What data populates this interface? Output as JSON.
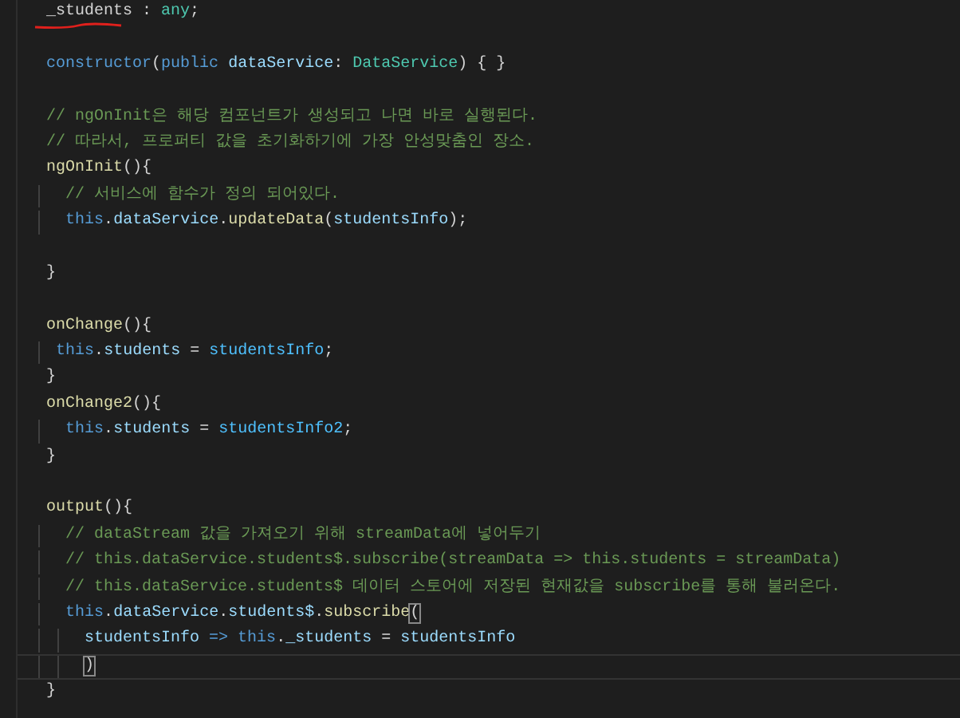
{
  "editor": {
    "lines": [
      {
        "current": false,
        "tokens": [
          {
            "kind": "plain",
            "text": "_students : "
          },
          {
            "kind": "type",
            "text": "any"
          },
          {
            "kind": "plain",
            "text": ";"
          }
        ]
      },
      {
        "current": false
      },
      {
        "current": false,
        "tokens": [
          {
            "kind": "keyword",
            "text": "constructor"
          },
          {
            "kind": "plain",
            "text": "("
          },
          {
            "kind": "keyword",
            "text": "public"
          },
          {
            "kind": "variable",
            "text": " dataService"
          },
          {
            "kind": "plain",
            "text": ": "
          },
          {
            "kind": "type",
            "text": "DataService"
          },
          {
            "kind": "plain",
            "text": ") { }"
          }
        ]
      },
      {
        "current": false
      },
      {
        "current": false,
        "tokens": [
          {
            "kind": "comment",
            "text": "// ngOnInit은 해당 컴포넌트가 생성되고 나면 바로 실행된다."
          }
        ]
      },
      {
        "current": false,
        "tokens": [
          {
            "kind": "comment",
            "text": "// 따라서, 프로퍼티 값을 초기화하기에 가장 안성맞춤인 장소."
          }
        ]
      },
      {
        "current": false,
        "tokens": [
          {
            "kind": "function",
            "text": "ngOnInit"
          },
          {
            "kind": "plain",
            "text": "(){"
          }
        ]
      },
      {
        "current": false,
        "tokens": [
          {
            "kind": "comment",
            "text": "  // 서비스에 함수가 정의 되어있다."
          }
        ]
      },
      {
        "current": false,
        "tokens": [
          {
            "kind": "keyword",
            "text": "  this"
          },
          {
            "kind": "plain",
            "text": "."
          },
          {
            "kind": "variable",
            "text": "dataService"
          },
          {
            "kind": "plain",
            "text": "."
          },
          {
            "kind": "function",
            "text": "updateData"
          },
          {
            "kind": "plain",
            "text": "("
          },
          {
            "kind": "variable",
            "text": "studentsInfo"
          },
          {
            "kind": "plain",
            "text": ");"
          }
        ]
      },
      {
        "current": false
      },
      {
        "current": false,
        "tokens": [
          {
            "kind": "plain",
            "text": "}"
          }
        ]
      },
      {
        "current": false
      },
      {
        "current": false,
        "tokens": [
          {
            "kind": "function",
            "text": "onChange"
          },
          {
            "kind": "plain",
            "text": "(){"
          }
        ]
      },
      {
        "current": false,
        "tokens": [
          {
            "kind": "keyword",
            "text": " this"
          },
          {
            "kind": "plain",
            "text": "."
          },
          {
            "kind": "variable",
            "text": "students"
          },
          {
            "kind": "plain",
            "text": " = "
          },
          {
            "kind": "ident",
            "text": "studentsInfo"
          },
          {
            "kind": "plain",
            "text": ";"
          }
        ]
      },
      {
        "current": false,
        "tokens": [
          {
            "kind": "plain",
            "text": "}"
          }
        ]
      },
      {
        "current": false,
        "tokens": [
          {
            "kind": "function",
            "text": "onChange2"
          },
          {
            "kind": "plain",
            "text": "(){"
          }
        ]
      },
      {
        "current": false,
        "tokens": [
          {
            "kind": "keyword",
            "text": "  this"
          },
          {
            "kind": "plain",
            "text": "."
          },
          {
            "kind": "variable",
            "text": "students"
          },
          {
            "kind": "plain",
            "text": " = "
          },
          {
            "kind": "ident",
            "text": "studentsInfo2"
          },
          {
            "kind": "plain",
            "text": ";"
          }
        ]
      },
      {
        "current": false,
        "tokens": [
          {
            "kind": "plain",
            "text": "}"
          }
        ]
      },
      {
        "current": false
      },
      {
        "current": false,
        "tokens": [
          {
            "kind": "function",
            "text": "output"
          },
          {
            "kind": "plain",
            "text": "(){"
          }
        ]
      },
      {
        "current": false,
        "tokens": [
          {
            "kind": "comment",
            "text": "  // dataStream 값을 가져오기 위해 streamData에 넣어두기"
          }
        ]
      },
      {
        "current": false,
        "tokens": [
          {
            "kind": "comment",
            "text": "  // this.dataService.students$.subscribe(streamData => this.students = streamData)"
          }
        ]
      },
      {
        "current": false,
        "tokens": [
          {
            "kind": "comment",
            "text": "  // this.dataService.students$ 데이터 스토어에 저장된 현재값을 subscribe를 통해 불러온다."
          }
        ]
      },
      {
        "current": false,
        "tokens": [
          {
            "kind": "keyword",
            "text": "  this"
          },
          {
            "kind": "plain",
            "text": "."
          },
          {
            "kind": "variable",
            "text": "dataService"
          },
          {
            "kind": "plain",
            "text": "."
          },
          {
            "kind": "variable",
            "text": "students$"
          },
          {
            "kind": "plain",
            "text": "."
          },
          {
            "kind": "function",
            "text": "subscribe"
          },
          {
            "kind": "bracket",
            "text": "("
          }
        ]
      },
      {
        "current": false,
        "tokens": [
          {
            "kind": "variable",
            "text": "    studentsInfo"
          },
          {
            "kind": "keyword",
            "text": " => this"
          },
          {
            "kind": "plain",
            "text": "."
          },
          {
            "kind": "variable",
            "text": "_students"
          },
          {
            "kind": "plain",
            "text": " = "
          },
          {
            "kind": "variable",
            "text": "studentsInfo"
          }
        ]
      },
      {
        "current": true,
        "tokens": [
          {
            "kind": "bracket",
            "text": "    )"
          }
        ]
      },
      {
        "current": false,
        "tokens": [
          {
            "kind": "plain",
            "text": "}"
          }
        ]
      }
    ]
  }
}
